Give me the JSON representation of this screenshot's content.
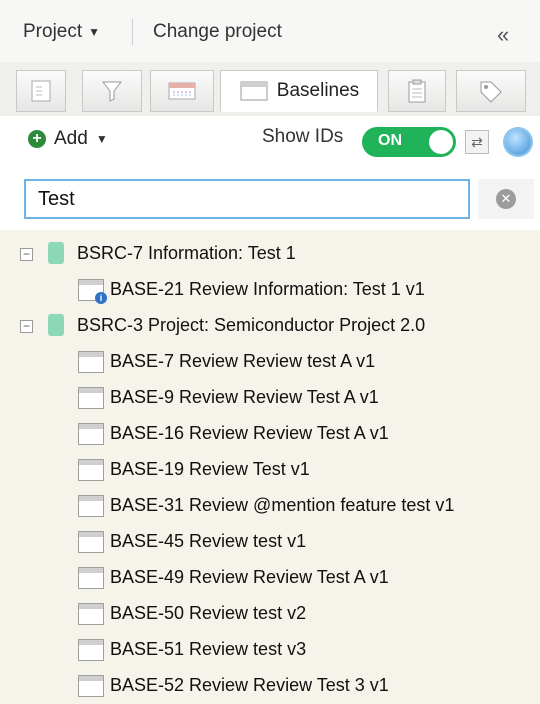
{
  "topbar": {
    "project_label": "Project",
    "change_project_label": "Change project",
    "collapse_glyph": "«"
  },
  "tabs": [
    {
      "icon": "tree-view-icon",
      "label": ""
    },
    {
      "icon": "filter-icon",
      "label": ""
    },
    {
      "icon": "timeline-icon",
      "label": ""
    },
    {
      "icon": "baseline-icon",
      "label": "Baselines",
      "active": true
    },
    {
      "icon": "clipboard-icon",
      "label": ""
    },
    {
      "icon": "tag-icon",
      "label": ""
    }
  ],
  "toolbar": {
    "add_label": "Add",
    "show_ids_label": "Show IDs",
    "toggle_state": "ON"
  },
  "search": {
    "value": "Test",
    "placeholder": ""
  },
  "tree": {
    "sources": [
      {
        "label": "BSRC-7 Information: Test 1",
        "children": [
          "BASE-21 Review Information: Test 1 v1"
        ]
      },
      {
        "label": "BSRC-3 Project: Semiconductor Project 2.0",
        "children": [
          "BASE-7 Review Review test A v1",
          "BASE-9 Review Review Test A v1",
          "BASE-16 Review Review Test A v1",
          "BASE-19 Review Test v1",
          "BASE-31 Review @mention feature test v1",
          "BASE-45 Review test v1",
          "BASE-49 Review Review Test A v1",
          "BASE-50 Review test v2",
          "BASE-51 Review test v3",
          "BASE-52 Review Review Test 3 v1"
        ]
      }
    ]
  },
  "colors": {
    "toggle_on": "#21b35a",
    "search_border": "#6fb4e8",
    "tree_background": "#f6f3ea",
    "source_icon": "#8ed8b9"
  }
}
